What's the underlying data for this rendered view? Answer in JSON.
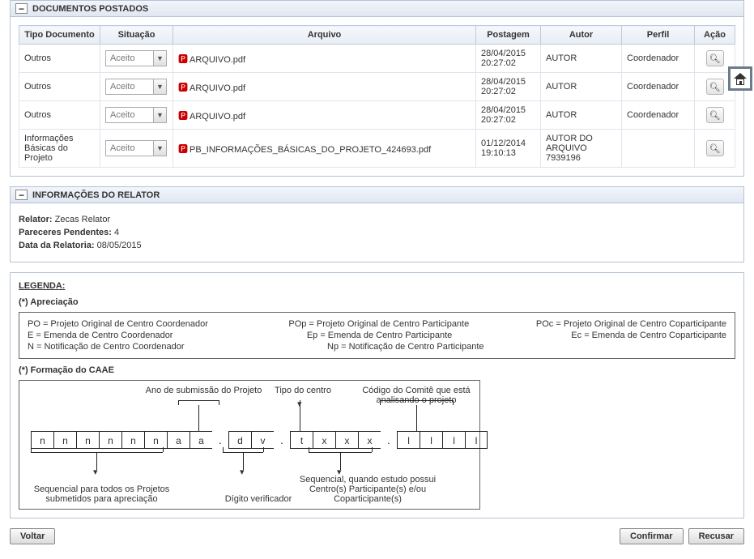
{
  "panels": {
    "documentos": {
      "title": "DOCUMENTOS POSTADOS",
      "columns": [
        "Tipo Documento",
        "Situação",
        "Arquivo",
        "Postagem",
        "Autor",
        "Perfil",
        "Ação"
      ],
      "rows": [
        {
          "tipo": "Outros",
          "situacao": "Aceito",
          "arquivo": "ARQUIVO.pdf",
          "postagem": "28/04/2015 20:27:02",
          "autor": "AUTOR",
          "perfil": "Coordenador"
        },
        {
          "tipo": "Outros",
          "situacao": "Aceito",
          "arquivo": "ARQUIVO.pdf",
          "postagem": "28/04/2015 20:27:02",
          "autor": "AUTOR",
          "perfil": "Coordenador"
        },
        {
          "tipo": "Outros",
          "situacao": "Aceito",
          "arquivo": "ARQUIVO.pdf",
          "postagem": "28/04/2015 20:27:02",
          "autor": "AUTOR",
          "perfil": "Coordenador"
        },
        {
          "tipo": "Informações Básicas do Projeto",
          "situacao": "Aceito",
          "arquivo": "PB_INFORMAÇÕES_BÁSICAS_DO_PROJETO_424693.pdf",
          "postagem": "01/12/2014 19:10:13",
          "autor": "AUTOR DO ARQUIVO 7939196",
          "perfil": ""
        }
      ]
    },
    "relator": {
      "title": "INFORMAÇÕES DO RELATOR",
      "fields": {
        "relator_label": "Relator:",
        "relator_value": "Zecas Relator",
        "pendentes_label": "Pareceres Pendentes:",
        "pendentes_value": "4",
        "data_label": "Data da Relatoria:",
        "data_value": "08/05/2015"
      }
    }
  },
  "legenda": {
    "title": "LEGENDA:",
    "apreciacao_title": "(*) Apreciação",
    "items": {
      "po": "PO = Projeto Original de Centro Coordenador",
      "pop": "POp = Projeto Original de Centro Participante",
      "poc": "POc = Projeto Original de Centro Coparticipante",
      "e": "E = Emenda de Centro Coordenador",
      "ep": "Ep = Emenda de Centro Participante",
      "ec": "Ec = Emenda de Centro Coparticipante",
      "n": "N = Notificação de Centro Coordenador",
      "np": "Np = Notificação de Centro Participante"
    },
    "caae_title": "(*) Formação do CAAE",
    "caae_cells": [
      "n",
      "n",
      "n",
      "n",
      "n",
      "n",
      "a",
      "a",
      ".",
      "d",
      "v",
      ".",
      "t",
      "x",
      "x",
      "x",
      ".",
      "I",
      "I",
      "I",
      "I"
    ],
    "caae_labels": {
      "ano": "Ano de submissão do Projeto",
      "tipo": "Tipo do centro",
      "codigo": "Código do Comitê que está analisando o projeto",
      "seq": "Sequencial para todos os Projetos submetidos para apreciação",
      "dv": "Dígito verificador",
      "seqcentro": "Sequencial, quando estudo possui Centro(s) Participante(s) e/ou Coparticipante(s)"
    }
  },
  "buttons": {
    "voltar": "Voltar",
    "confirmar": "Confirmar",
    "recusar": "Recusar"
  }
}
